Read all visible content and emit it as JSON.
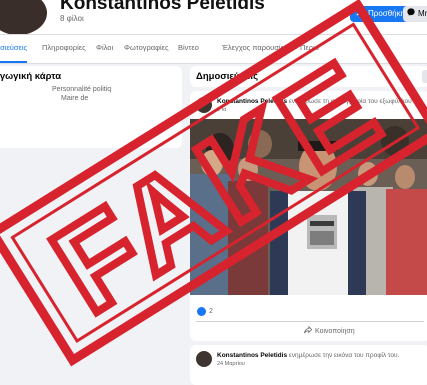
{
  "header": {
    "name": "Konstantinos Peletidis",
    "friends": "8 φίλοι",
    "follow_label": "Προσθήκη",
    "message_label": "Μη"
  },
  "tabs": [
    "οσιεύσεις",
    "Πληροφορίες",
    "Φίλοι",
    "Φωτογραφίες",
    "Βίντεο",
    "Έλεγχος παρουσίας",
    "Περισ"
  ],
  "intro": {
    "title": "αγωγική κάρτα",
    "line1": "Personnalité politiq",
    "line2": "Maire de"
  },
  "posts_section": {
    "title": "Δημοσιεύσεις"
  },
  "post1": {
    "author": "Konstantinos Peletidis",
    "prefix": "",
    "action": "ενημέρωσε τη φωτογραφία του εξωφύλλου",
    "time": "2 Ια",
    "reaction_count": "2",
    "share_label": "Κοινοποίηση"
  },
  "post2": {
    "author": "Konstantinos Peletidis",
    "prefix": "",
    "action": "ενημέρωσε την εικόνα του προφίλ του.",
    "time": "24 Μαρτίου"
  },
  "stamp": {
    "text": "FAKE",
    "color": "#d7232d"
  },
  "colors": {
    "accent": "#1877f2",
    "page_bg": "#f0f2f5"
  }
}
